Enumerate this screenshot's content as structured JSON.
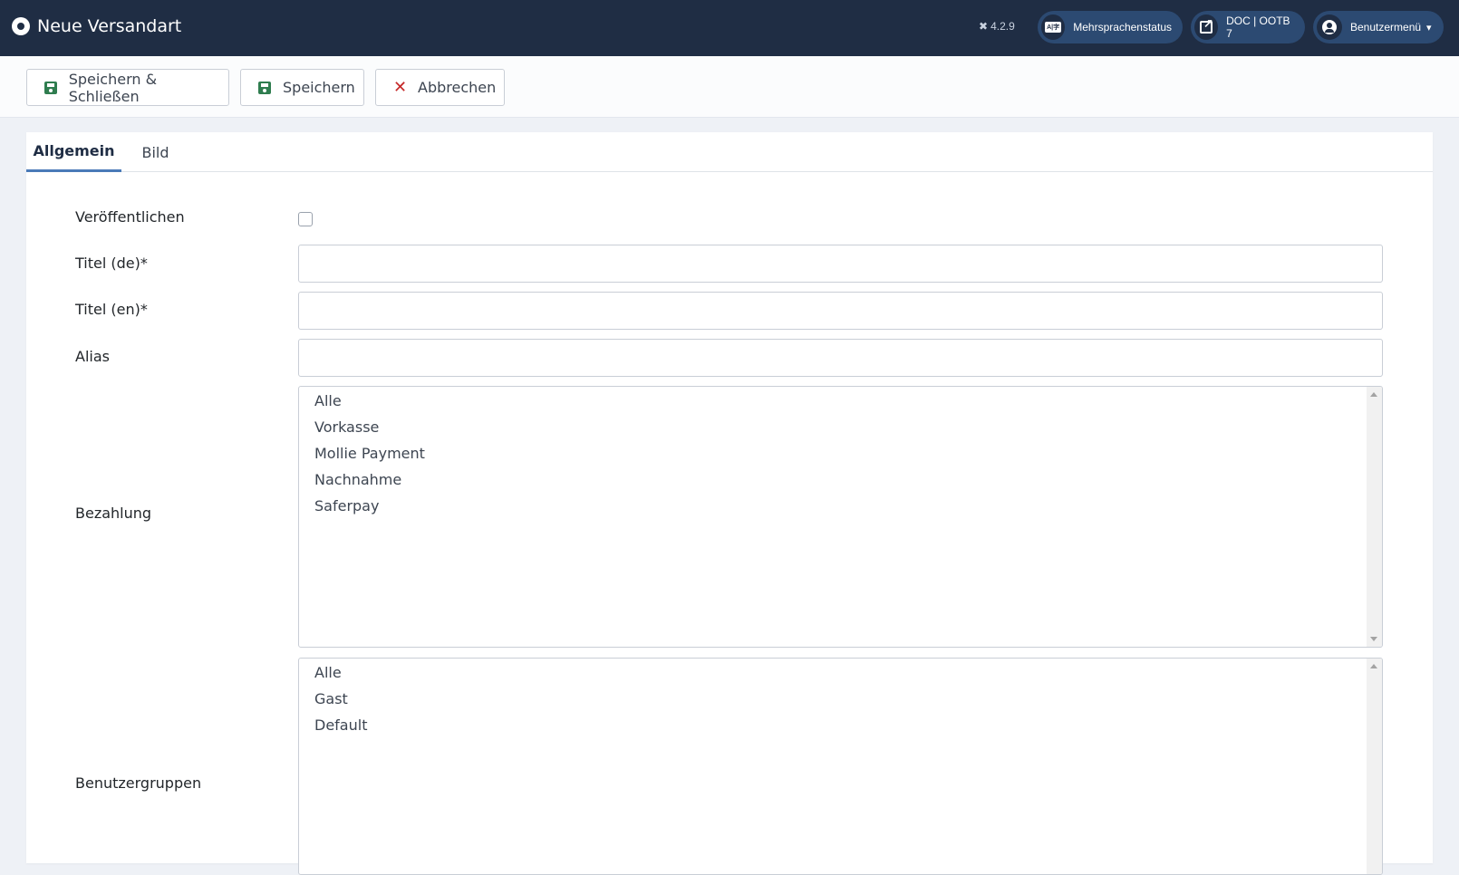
{
  "header": {
    "title": "Neue Versandart",
    "version": "4.2.9",
    "multilang_label": "Mehrsprachenstatus",
    "doc_label": "DOC | OOTB 7",
    "user_label": "Benutzermenü"
  },
  "toolbar": {
    "save_close_label": "Speichern & Schließen",
    "save_label": "Speichern",
    "cancel_label": "Abbrechen"
  },
  "tabs": [
    {
      "label": "Allgemein",
      "active": true
    },
    {
      "label": "Bild",
      "active": false
    }
  ],
  "form": {
    "publish_label": "Veröffentlichen",
    "title_de_label": "Titel (de)*",
    "title_en_label": "Titel (en)*",
    "alias_label": "Alias",
    "payment_label": "Bezahlung",
    "payment_options": [
      "Alle",
      "Vorkasse",
      "Mollie Payment",
      "Nachnahme",
      "Saferpay"
    ],
    "usergroups_label": "Benutzergruppen",
    "usergroups_options": [
      "Alle",
      "Gast",
      "Default"
    ]
  },
  "colors": {
    "header_bg": "#1f2d44",
    "pill_bg": "#2c4a72",
    "save_icon": "#2f7d4f",
    "cancel_icon": "#c52828",
    "tab_active": "#4a7ab8"
  },
  "icons": {
    "logo": "joomla-circle-icon",
    "version": "joomla-icon",
    "multilang": "language-icon",
    "doc": "external-link-icon",
    "user": "user-circle-icon",
    "save": "save-icon",
    "cancel": "close-icon"
  }
}
